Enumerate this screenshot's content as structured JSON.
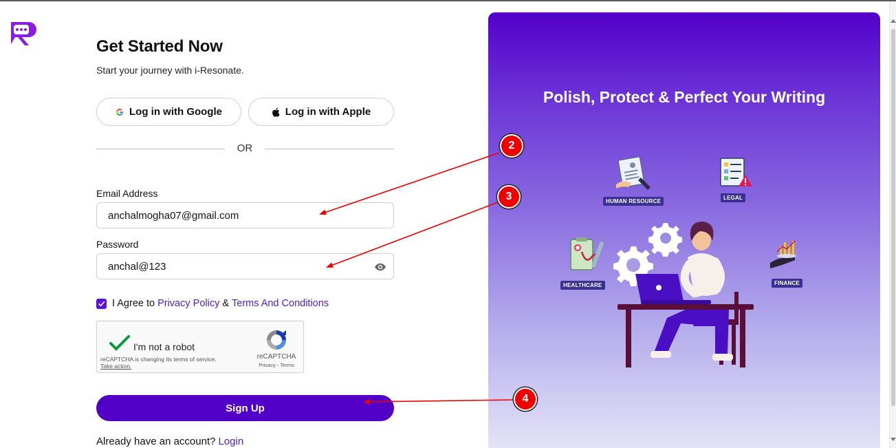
{
  "brand": {
    "logo": "i-resonate-logo-icon",
    "accent": "#5200c7"
  },
  "form": {
    "title": "Get Started Now",
    "subtitle": "Start your journey with i-Resonate.",
    "google_label": "Log in with Google",
    "apple_label": "Log in with Apple",
    "or_label": "OR",
    "email_label": "Email Address",
    "email_value": "anchalmogha07@gmail.com",
    "password_label": "Password",
    "password_value": "anchal@123",
    "agree_prefix": "I Agree to",
    "privacy_link": "Privacy Policy",
    "amp": "&",
    "terms_link": "Terms And Conditions",
    "agree_checked": true,
    "signup_label": "Sign Up",
    "already_text": "Already have an account?",
    "login_link": "Login"
  },
  "captcha": {
    "label": "I'm not a robot",
    "notice": "reCAPTCHA is changing its terms of service.",
    "take_action": "Take action.",
    "brand": "reCAPTCHA",
    "links": "Privacy - Terms"
  },
  "panel": {
    "title": "Polish, Protect & Perfect Your Writing",
    "badges": {
      "human_resource": "HUMAN RESOURCE",
      "legal": "LEGAL",
      "healthcare": "HEALTHCARE",
      "finance": "FINANCE"
    }
  },
  "annotations": {
    "marker_2": "2",
    "marker_3": "3",
    "marker_4": "4",
    "color": "#ee0000"
  }
}
